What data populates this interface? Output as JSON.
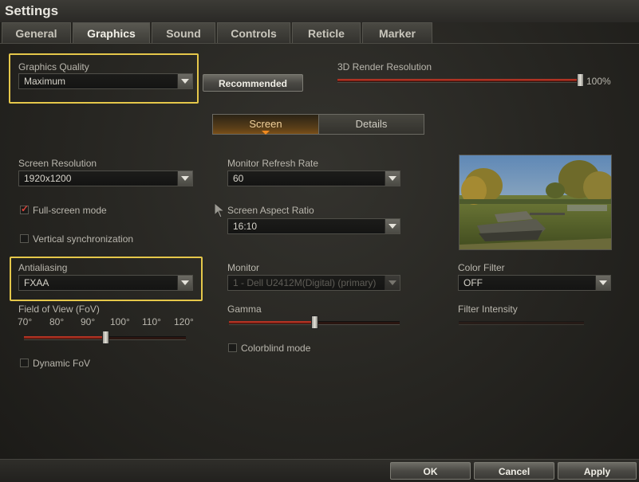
{
  "window": {
    "title": "Settings"
  },
  "tabs": [
    {
      "label": "General",
      "active": false
    },
    {
      "label": "Graphics",
      "active": true
    },
    {
      "label": "Sound",
      "active": false
    },
    {
      "label": "Controls",
      "active": false
    },
    {
      "label": "Reticle",
      "active": false
    },
    {
      "label": "Marker",
      "active": false
    }
  ],
  "graphics_quality": {
    "label": "Graphics Quality",
    "value": "Maximum",
    "recommended_button": "Recommended"
  },
  "render_resolution": {
    "label": "3D Render Resolution",
    "value_text": "100%",
    "value": 1.0
  },
  "subtabs": {
    "screen": "Screen",
    "details": "Details",
    "active": "screen"
  },
  "screen": {
    "resolution": {
      "label": "Screen Resolution",
      "value": "1920x1200"
    },
    "fullscreen": {
      "label": "Full-screen mode",
      "checked": true
    },
    "vsync": {
      "label": "Vertical synchronization",
      "checked": false
    },
    "antialiasing": {
      "label": "Antialiasing",
      "value": "FXAA"
    },
    "fov": {
      "label": "Field of View (FoV)",
      "ticks": [
        "70°",
        "80°",
        "90°",
        "100°",
        "110°",
        "120°"
      ],
      "value": 95,
      "min": 70,
      "max": 120
    },
    "dynamic_fov": {
      "label": "Dynamic FoV",
      "checked": false
    },
    "refresh_rate": {
      "label": "Monitor Refresh Rate",
      "value": "60"
    },
    "aspect_ratio": {
      "label": "Screen Aspect Ratio",
      "value": "16:10"
    },
    "monitor": {
      "label": "Monitor",
      "value": "1 - Dell U2412M(Digital) (primary)",
      "disabled": true
    },
    "gamma": {
      "label": "Gamma",
      "value": 0.5
    },
    "colorblind": {
      "label": "Colorblind mode",
      "checked": false
    },
    "color_filter": {
      "label": "Color Filter",
      "value": "OFF"
    },
    "filter_intensity": {
      "label": "Filter Intensity",
      "value": 0
    }
  },
  "footer": {
    "ok": "OK",
    "cancel": "Cancel",
    "apply": "Apply"
  },
  "colors": {
    "highlight": "#e5c74a",
    "accent": "#c43b2a",
    "active_subtab": "#7a4f18"
  }
}
